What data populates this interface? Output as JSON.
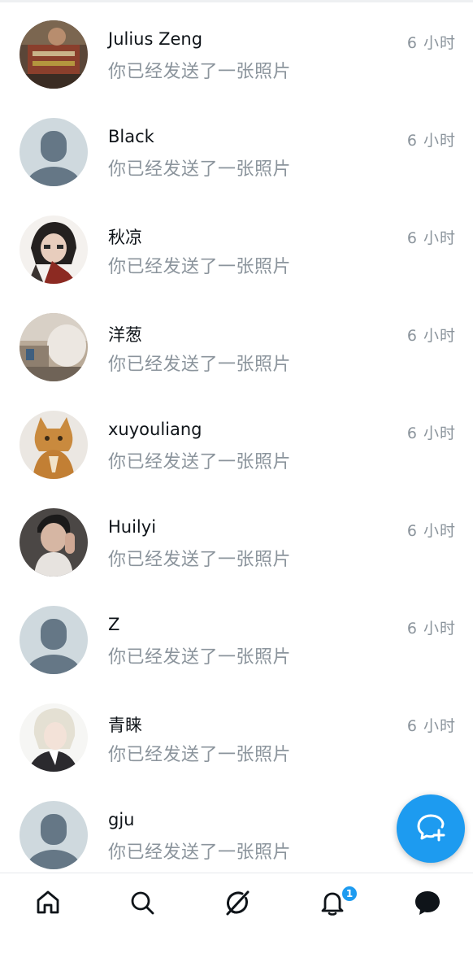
{
  "conversations": [
    {
      "name": "Julius Zeng",
      "preview": "你已经发送了一张照片",
      "time": "6 小时",
      "avatar": "photo-dark"
    },
    {
      "name": "Black",
      "preview": "你已经发送了一张照片",
      "time": "6 小时",
      "avatar": "default"
    },
    {
      "name": "秋凉",
      "preview": "你已经发送了一张照片",
      "time": "6 小时",
      "avatar": "anime-dark"
    },
    {
      "name": "洋葱",
      "preview": "你已经发送了一张照片",
      "time": "6 小时",
      "avatar": "photo-room"
    },
    {
      "name": "xuyouliang",
      "preview": "你已经发送了一张照片",
      "time": "6 小时",
      "avatar": "cat"
    },
    {
      "name": "Huilyi",
      "preview": "你已经发送了一张照片",
      "time": "6 小时",
      "avatar": "photo-person"
    },
    {
      "name": "Z",
      "preview": "你已经发送了一张照片",
      "time": "6 小时",
      "avatar": "default"
    },
    {
      "name": "青睐",
      "preview": "你已经发送了一张照片",
      "time": "6 小时",
      "avatar": "anime-light"
    },
    {
      "name": "gju",
      "preview": "你已经发送了一张照片",
      "time": "",
      "avatar": "default"
    }
  ],
  "fab": {
    "icon": "new-message-icon"
  },
  "tabbar": {
    "tabs": [
      {
        "name": "home",
        "icon": "home-icon"
      },
      {
        "name": "search",
        "icon": "search-icon"
      },
      {
        "name": "grok",
        "icon": "grok-icon"
      },
      {
        "name": "notifications",
        "icon": "bell-icon"
      },
      {
        "name": "messages",
        "icon": "messages-icon"
      }
    ],
    "notification_badge": "1"
  },
  "colors": {
    "accent": "#1d9bf0",
    "text": "#0f1419",
    "secondary": "#8b949c",
    "default_avatar_bg": "#cfd9de",
    "default_avatar_fg": "#657786"
  }
}
